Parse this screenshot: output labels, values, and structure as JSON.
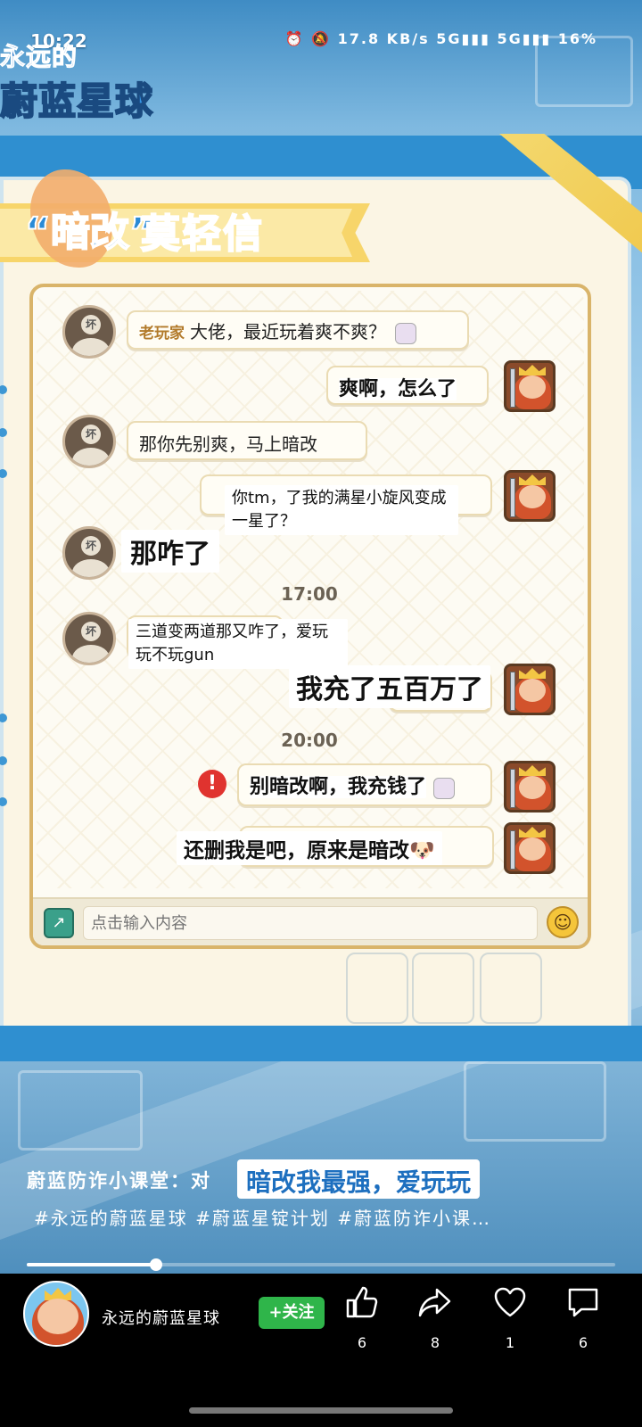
{
  "status_bar": {
    "time": "10:22",
    "indicators": "⏰ 🔕 17.8 KB/s 5G▮▮▮ 5G▮▮▮ 16%"
  },
  "game_logo": {
    "line1": "永远的",
    "line2": "蔚蓝星球"
  },
  "panel": {
    "title_hidden": "“暗改”",
    "title_visible": "莫轻信"
  },
  "chat": {
    "messages": [
      {
        "side": "left",
        "nickname": "老玩家",
        "text": "大佬，最近玩着爽不爽？"
      },
      {
        "side": "right",
        "text": "爽啊，怎么了"
      },
      {
        "side": "left",
        "text": "那你先别爽，马上暗改"
      },
      {
        "side": "right",
        "text": "你tm，了我的满星小旋风变成一星了？"
      },
      {
        "side": "left",
        "text": "那咋了"
      },
      {
        "side": "left",
        "text": "三道变两道那又咋了，爱玩玩不玩gun"
      },
      {
        "side": "right",
        "text": "我充了五百万了"
      },
      {
        "side": "right",
        "text": "别暗改啊，我充钱了"
      },
      {
        "side": "right",
        "text": "还删我是吧，原来是暗改🐶"
      }
    ],
    "timestamps": [
      "17:00",
      "20:00"
    ],
    "avatar_label": "坏",
    "warn_symbol": "!",
    "input_placeholder": "点击输入内容"
  },
  "video": {
    "caption_prefix": "蔚蓝防诈小课堂：对",
    "caption_highlight": "暗改我最强，爱玩玩",
    "hashtags": "#永远的蔚蓝星球 #蔚蓝星锭计划 #蔚蓝防诈小课…",
    "progress_fraction": 0.22
  },
  "bottom_bar": {
    "channel_name": "永远的蔚蓝星球",
    "follow_label": "+关注",
    "actions": [
      {
        "icon": "thumbs-up-icon",
        "count": "6"
      },
      {
        "icon": "share-icon",
        "count": "8"
      },
      {
        "icon": "heart-icon",
        "count": "1"
      },
      {
        "icon": "comment-icon",
        "count": "6"
      }
    ]
  }
}
